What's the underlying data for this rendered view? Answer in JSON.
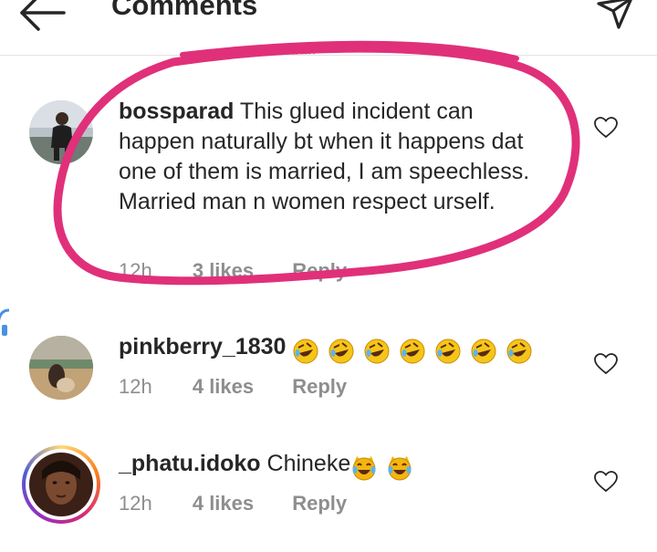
{
  "header": {
    "title": "Comments"
  },
  "comments": [
    {
      "username": "bossparad",
      "text": " This glued incident can happen naturally bt when it happens dat one of them is married, I am speechless.  Married man n women respect urself.",
      "time": "12h",
      "likes": "3 likes",
      "reply": "Reply"
    },
    {
      "username": "pinkberry_1830",
      "text": "",
      "emoji": [
        "rofl-emoji",
        "rofl-emoji",
        "rofl-emoji",
        "rofl-emoji",
        "rofl-emoji",
        "rofl-emoji",
        "rofl-emoji"
      ],
      "time": "12h",
      "likes": "4 likes",
      "reply": "Reply"
    },
    {
      "username": "_phatu.idoko",
      "text": " Chineke",
      "emoji": [
        "laughing-cat-emoji",
        "laughing-cat-emoji"
      ],
      "time": "12h",
      "likes": "4 likes",
      "reply": "Reply"
    }
  ],
  "colors": {
    "text": "#262626",
    "meta": "#8e8e8e",
    "annotation": "#e0307a",
    "divider": "#e4e4e4"
  },
  "icons": {
    "back": "arrow-left-icon",
    "send": "paper-plane-icon",
    "like": "heart-outline-icon"
  }
}
